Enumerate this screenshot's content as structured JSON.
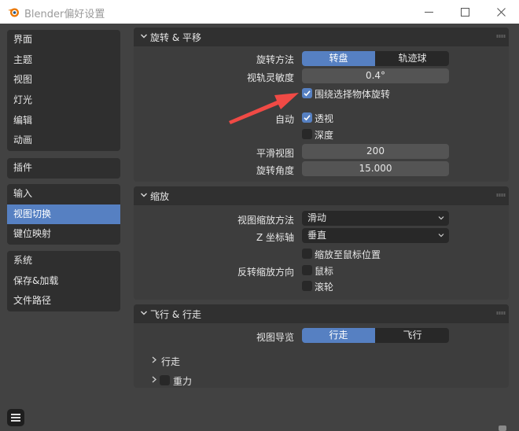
{
  "window": {
    "title": "Blender偏好设置"
  },
  "sidebar": {
    "groups": [
      {
        "items": [
          {
            "label": "界面"
          },
          {
            "label": "主题"
          },
          {
            "label": "视图"
          },
          {
            "label": "灯光"
          },
          {
            "label": "编辑"
          },
          {
            "label": "动画"
          }
        ]
      },
      {
        "items": [
          {
            "label": "插件"
          }
        ]
      },
      {
        "items": [
          {
            "label": "输入"
          },
          {
            "label": "视图切换",
            "active": true
          },
          {
            "label": "键位映射"
          }
        ]
      },
      {
        "items": [
          {
            "label": "系统"
          },
          {
            "label": "保存&加载"
          },
          {
            "label": "文件路径"
          }
        ]
      }
    ]
  },
  "orbit_pan": {
    "title": "旋转 & 平移",
    "orbit_method_label": "旋转方法",
    "orbit_method_options": [
      "转盘",
      "轨迹球"
    ],
    "orbit_sensitivity_label": "视轨灵敏度",
    "orbit_sensitivity_value": "0.4°",
    "orbit_around_selection": "围绕选择物体旋转",
    "auto_label": "自动",
    "auto_perspective": "透视",
    "auto_depth": "深度",
    "smooth_view_label": "平滑视图",
    "smooth_view_value": "200",
    "rotation_angle_label": "旋转角度",
    "rotation_angle_value": "15.000"
  },
  "zoom": {
    "title": "缩放",
    "zoom_method_label": "视图缩放方法",
    "zoom_method_value": "滑动",
    "z_axis_label": "Z 坐标轴",
    "z_axis_value": "垂直",
    "zoom_to_mouse": "缩放至鼠标位置",
    "invert_zoom_label": "反转缩放方向",
    "invert_mouse": "鼠标",
    "invert_wheel": "滚轮"
  },
  "fly_walk": {
    "title": "飞行 & 行走",
    "view_nav_label": "视图导览",
    "view_nav_options": [
      "行走",
      "飞行"
    ],
    "walk_subpanel": "行走",
    "gravity_subpanel": "重力"
  },
  "colors": {
    "accent": "#5680c2",
    "annotation_arrow": "#f04a45"
  }
}
